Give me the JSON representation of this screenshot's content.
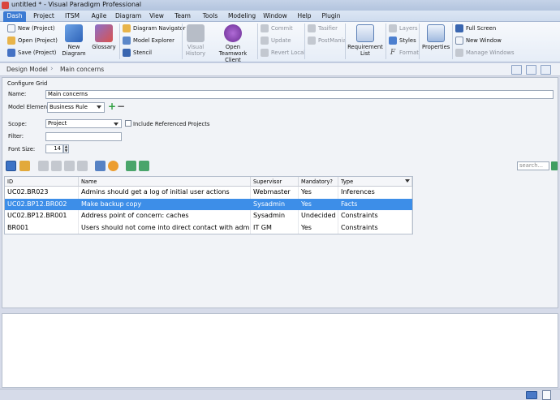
{
  "window": {
    "title": "untitled * - Visual Paradigm Professional"
  },
  "menu": [
    "Dash",
    "Project",
    "ITSM",
    "Agile",
    "Diagram",
    "View",
    "Team",
    "Tools",
    "Modeling",
    "Window",
    "Help",
    "Plugin"
  ],
  "ribbon": {
    "new_project": "New (Project)",
    "open_project": "Open (Project)",
    "save_project": "Save (Project)",
    "new_diagram": "New\nDiagram",
    "glossary": "Glossary",
    "diagram_navigator": "Diagram Navigator",
    "model_explorer": "Model Explorer",
    "stencil": "Stencil",
    "visual_history": "Visual\nHistory",
    "open_teamwork_client": "Open Teamwork\nClient",
    "commit": "Commit",
    "update": "Update",
    "revert_local": "Revert Local",
    "tasifier": "Tasifier",
    "postmania": "PostMania",
    "requirement_list": "Requirement\nList",
    "layers": "Layers",
    "styles": "Styles",
    "format": "Format",
    "properties": "Properties",
    "full_screen": "Full Screen",
    "new_window": "New Window",
    "manage_windows": "Manage Windows"
  },
  "breadcrumb": [
    "Design Model",
    "Main concerns"
  ],
  "config": {
    "section_title": "Configure Grid",
    "name_label": "Name:",
    "name_value": "Main concerns",
    "model_element_label": "Model Element:",
    "model_element_value": "Business Rule",
    "scope_label": "Scope:",
    "scope_value": "Project",
    "include_referenced_label": "Include Referenced Projects",
    "filter_label": "Filter:",
    "filter_value": "",
    "font_size_label": "Font Size:",
    "font_size_value": "14"
  },
  "search": {
    "placeholder": "search..."
  },
  "grid": {
    "columns": [
      "ID",
      "Name",
      "Supervisor",
      "Mandatory?",
      "Type"
    ],
    "rows": [
      {
        "id": "UC02.BR023",
        "name": "Admins should get a log of initial user actions",
        "supervisor": "Webmaster",
        "mandatory": "Yes",
        "type": "Inferences"
      },
      {
        "id": "UC02.BP12.BR002",
        "name": "Make backup copy",
        "supervisor": "Sysadmin",
        "mandatory": "Yes",
        "type": "Facts"
      },
      {
        "id": "UC02.BP12.BR001",
        "name": "Address point of concern: caches",
        "supervisor": "Sysadmin",
        "mandatory": "Undecided",
        "type": "Constraints"
      },
      {
        "id": "BR001",
        "name": "Users should not come into direct contact with admins",
        "supervisor": "IT GM",
        "mandatory": "Yes",
        "type": "Constraints"
      }
    ],
    "selected_row": 1
  },
  "colors": {
    "accent": "#3c7bd3",
    "selection": "#3d8ee8"
  }
}
